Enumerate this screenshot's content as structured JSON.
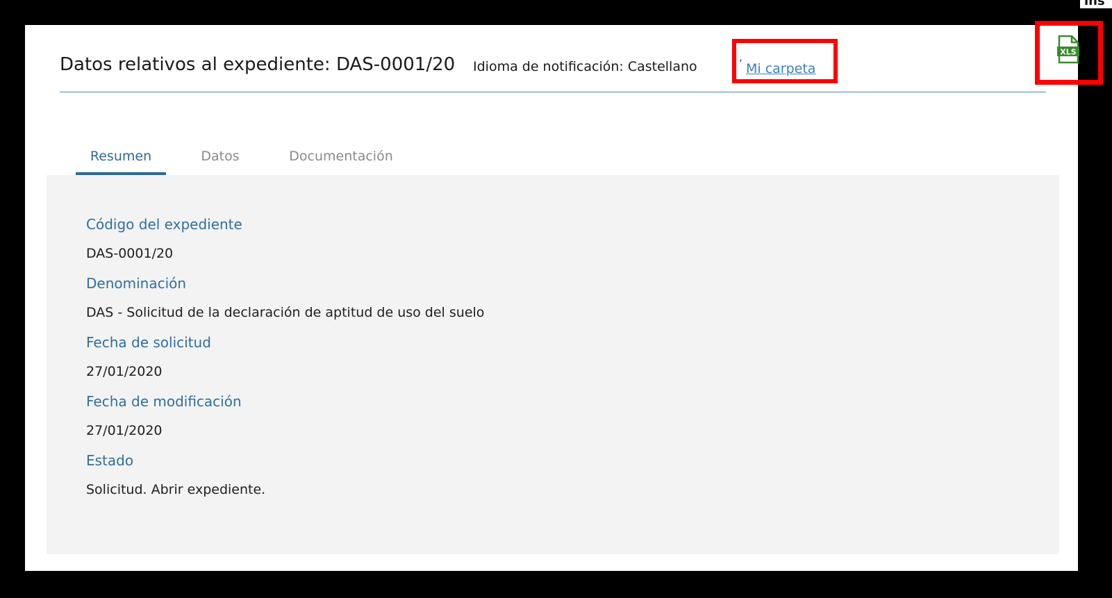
{
  "header": {
    "title_prefix": "Datos relativos al expediente:",
    "title_code": "DAS-0001/20",
    "language": "Idioma de notificación: Castellano",
    "folder_link": "Mi carpeta",
    "export_icon": "xls-file-icon",
    "export_icon_text": "XLS"
  },
  "tabs": [
    {
      "label": "Resumen",
      "active": true
    },
    {
      "label": "Datos",
      "active": false
    },
    {
      "label": "Documentación",
      "active": false
    }
  ],
  "summary": [
    {
      "label": "Código del expediente",
      "value": "DAS-0001/20"
    },
    {
      "label": "Denominación",
      "value": "DAS - Solicitud de la declaración de aptitud de uso del suelo"
    },
    {
      "label": "Fecha de solicitud",
      "value": "27/01/2020"
    },
    {
      "label": "Fecha de modificación",
      "value": "27/01/2020"
    },
    {
      "label": "Estado",
      "value": "Solicitud. Abrir expediente."
    }
  ],
  "colors": {
    "accent": "#2c6a99",
    "link": "#3a7ec0",
    "highlight_border": "#ff0000",
    "xls_green": "#3a8a2e",
    "panel_background": "#f3f3f3"
  }
}
